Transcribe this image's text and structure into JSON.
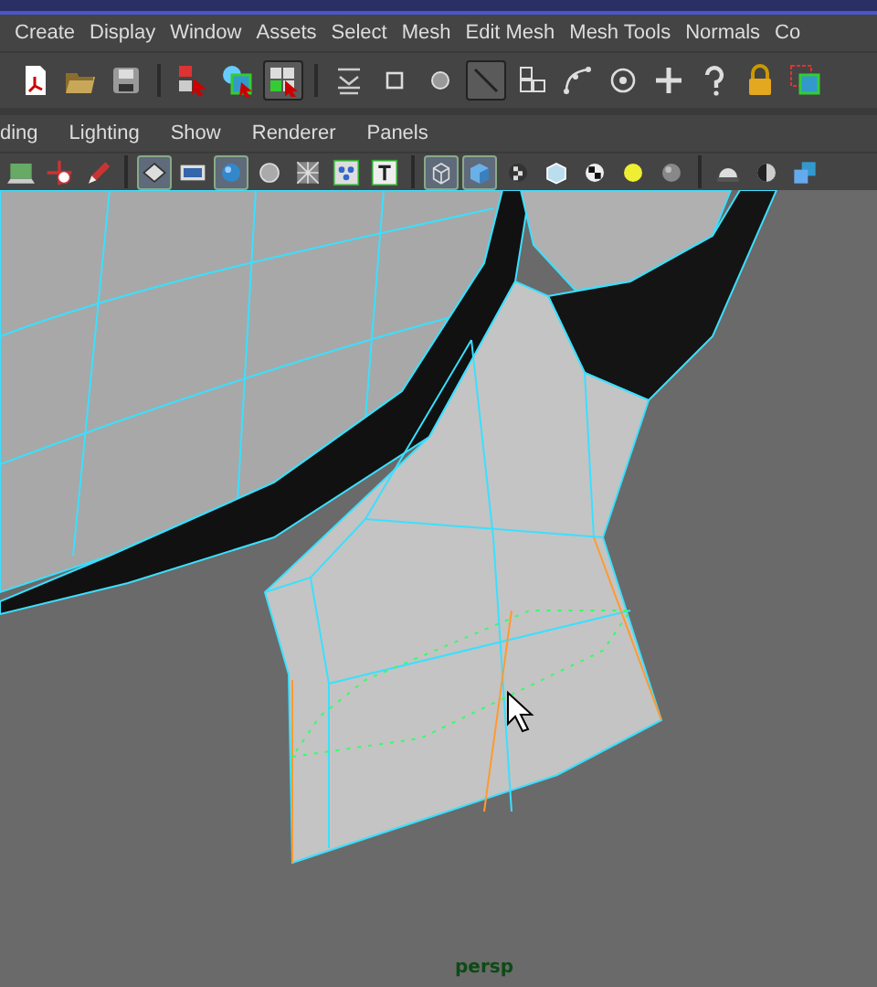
{
  "menu_bar": [
    "Create",
    "Display",
    "Window",
    "Assets",
    "Select",
    "Mesh",
    "Edit Mesh",
    "Mesh Tools",
    "Normals",
    "Co"
  ],
  "status_tools": [
    {
      "selected": false
    },
    {
      "selected": false
    },
    {
      "selected": false
    },
    {
      "selected": false
    },
    {
      "selected": false
    },
    {
      "selected": true
    },
    {
      "selected": false
    },
    {
      "selected": false
    },
    {
      "selected": false
    },
    {
      "selected": true
    },
    {
      "selected": false
    },
    {
      "selected": false
    },
    {
      "selected": false
    },
    {
      "selected": false
    },
    {
      "selected": false
    },
    {
      "selected": false
    },
    {
      "selected": false
    }
  ],
  "panel_menu": [
    "ding",
    "Lighting",
    "Show",
    "Renderer",
    "Panels"
  ],
  "panel_tools": [
    {
      "selected": false
    },
    {
      "selected": false
    },
    {
      "selected": false
    },
    {
      "selected": true
    },
    {
      "selected": false
    },
    {
      "selected": true
    },
    {
      "selected": false
    },
    {
      "selected": false
    },
    {
      "selected": false
    },
    {
      "selected": false
    },
    {
      "selected": true
    },
    {
      "selected": true
    },
    {
      "selected": false
    },
    {
      "selected": false
    },
    {
      "selected": false
    },
    {
      "selected": false
    },
    {
      "selected": false
    },
    {
      "selected": false
    },
    {
      "selected": false
    },
    {
      "selected": false
    }
  ],
  "viewport": {
    "camera_label": "persp"
  }
}
